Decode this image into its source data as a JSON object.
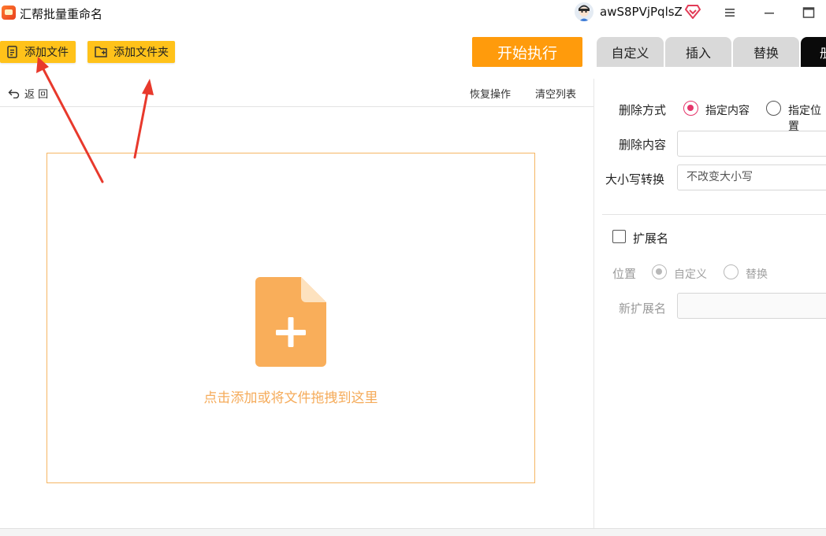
{
  "window": {
    "app_title": "汇帮批量重命名",
    "username": "awS8PVjPqlsZ",
    "icons": {
      "logo": "app-logo-icon",
      "avatar": "avatar-icon",
      "vip": "vip-diamond-icon",
      "menu": "hamburger-menu-icon",
      "minimize": "minimize-icon",
      "maximize": "maximize-icon"
    }
  },
  "toolbar": {
    "add_file_label": "添加文件",
    "add_folder_label": "添加文件夹",
    "start_label": "开始执行",
    "tabs": [
      {
        "label": "自定义",
        "active": false
      },
      {
        "label": "插入",
        "active": false
      },
      {
        "label": "替换",
        "active": false
      },
      {
        "label": "册",
        "active": true
      }
    ]
  },
  "subbar": {
    "undo_label": "返  回",
    "restore_label": "恢复操作",
    "clear_label": "清空列表"
  },
  "dropzone": {
    "hint": "点击添加或将文件拖拽到这里"
  },
  "right_panel": {
    "delete_mode_label": "删除方式",
    "delete_mode_options": [
      "指定内容",
      "指定位置"
    ],
    "delete_mode_selected": "指定内容",
    "delete_content_label": "删除内容",
    "delete_content_value": "",
    "case_label": "大小写转换",
    "case_value": "不改变大小写",
    "extension_label": "扩展名",
    "position_label": "位置",
    "position_options": [
      "自定义",
      "替换"
    ],
    "position_selected": "自定义",
    "new_ext_label": "新扩展名",
    "new_ext_value": ""
  },
  "colors": {
    "accent_yellow": "#ffc21a",
    "start_orange": "#ff9b0c",
    "drop_border": "#f5b664",
    "drop_icon": "#f9ae5a",
    "radio_selected": "#e5356a",
    "arrow_red": "#e8392c"
  }
}
